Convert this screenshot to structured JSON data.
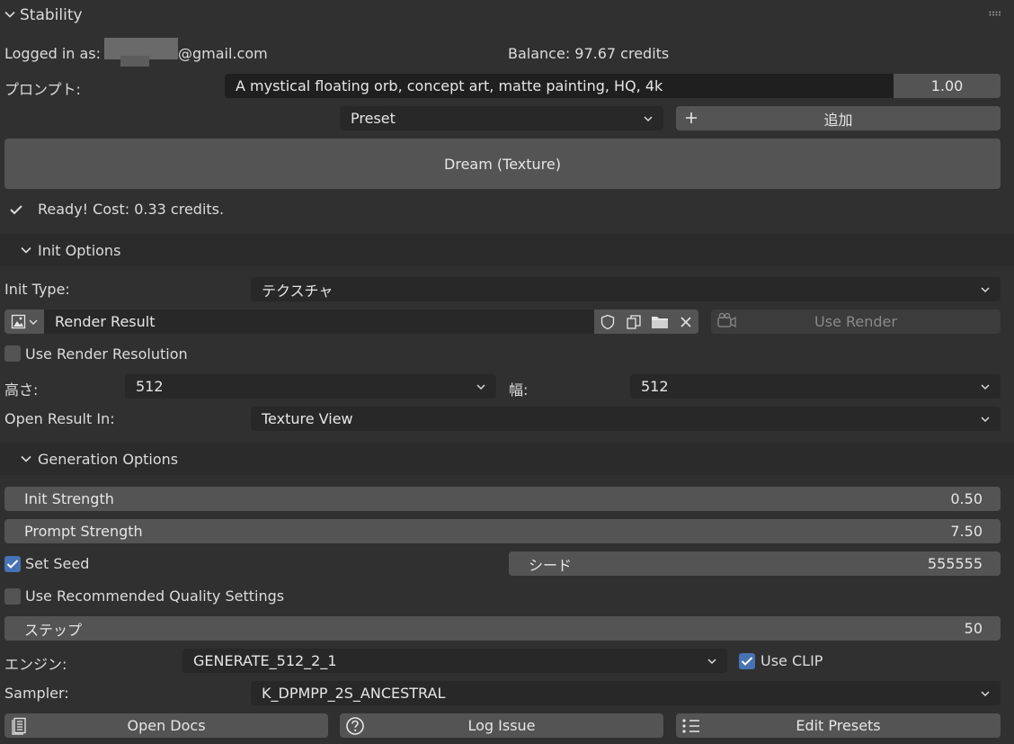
{
  "panel": {
    "title": "Stability",
    "grip_icon": "grip-icon"
  },
  "account": {
    "logged_in_label": "Logged in as:",
    "email_suffix": "@gmail.com",
    "balance": "Balance: 97.67 credits"
  },
  "prompt": {
    "label": "プロンプト:",
    "value": "A mystical floating orb, concept art, matte painting, HQ, 4k",
    "weight": "1.00"
  },
  "preset": {
    "selected": "Preset",
    "add_label": "追加"
  },
  "dream_button": "Dream (Texture)",
  "status": "Ready! Cost: 0.33 credits.",
  "init_options": {
    "header": "Init Options",
    "init_type_label": "Init Type:",
    "init_type_value": "テクスチャ",
    "image_name": "Render Result",
    "use_render_label": "Use Render",
    "use_render_resolution_label": "Use Render Resolution",
    "use_render_resolution_checked": false,
    "height_label": "高さ:",
    "height_value": "512",
    "width_label": "幅:",
    "width_value": "512",
    "open_result_label": "Open Result In:",
    "open_result_value": "Texture View"
  },
  "generation_options": {
    "header": "Generation Options",
    "init_strength_label": "Init Strength",
    "init_strength_value": "0.50",
    "prompt_strength_label": "Prompt Strength",
    "prompt_strength_value": "7.50",
    "set_seed_label": "Set Seed",
    "set_seed_checked": true,
    "seed_label": "シード",
    "seed_value": "555555",
    "use_recommended_label": "Use Recommended Quality Settings",
    "use_recommended_checked": false,
    "steps_label": "ステップ",
    "steps_value": "50",
    "engine_label": "エンジン:",
    "engine_value": "GENERATE_512_2_1",
    "use_clip_label": "Use CLIP",
    "use_clip_checked": true,
    "sampler_label": "Sampler:",
    "sampler_value": "K_DPMPP_2S_ANCESTRAL"
  },
  "footer": {
    "open_docs": "Open Docs",
    "log_issue": "Log Issue",
    "edit_presets": "Edit Presets"
  },
  "colors": {
    "panel_bg": "#303030",
    "field_bg": "#282828",
    "button_bg": "#545454",
    "accent_blue": "#4772b3"
  }
}
